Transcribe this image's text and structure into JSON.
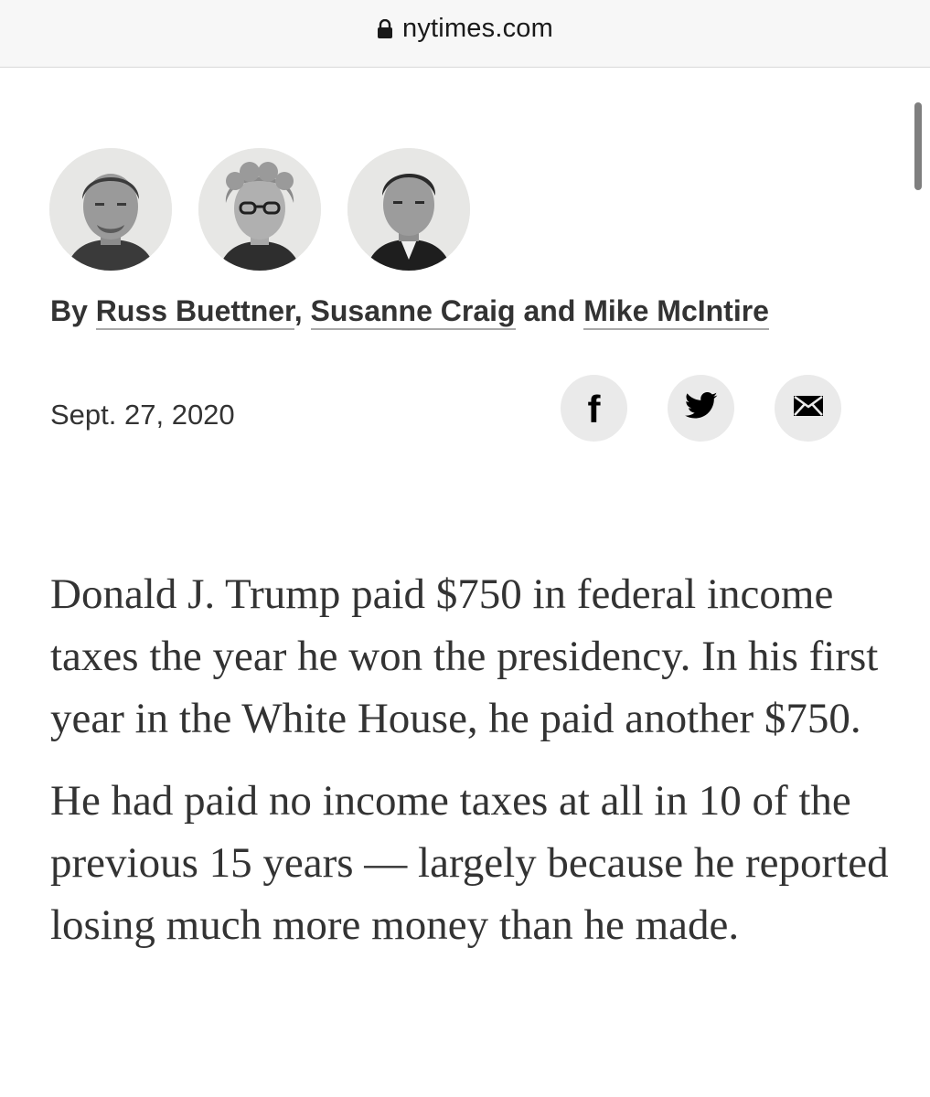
{
  "browser": {
    "url": "nytimes.com"
  },
  "article": {
    "byline": {
      "prefix": "By",
      "authors": [
        "Russ Buettner",
        "Susanne Craig",
        "Mike McIntire"
      ],
      "sep1": ",",
      "sep2": "and"
    },
    "date": "Sept. 27, 2020",
    "share": {
      "facebook_glyph": "f",
      "icons": [
        "facebook-icon",
        "twitter-icon",
        "email-icon"
      ]
    },
    "paragraphs": [
      "Donald J. Trump paid $750 in federal income taxes the year he won the presidency. In his first year in the White House, he paid another $750.",
      "He had paid no income taxes at all in 10 of the previous 15 years — largely because he reported losing much more money than he made."
    ]
  }
}
